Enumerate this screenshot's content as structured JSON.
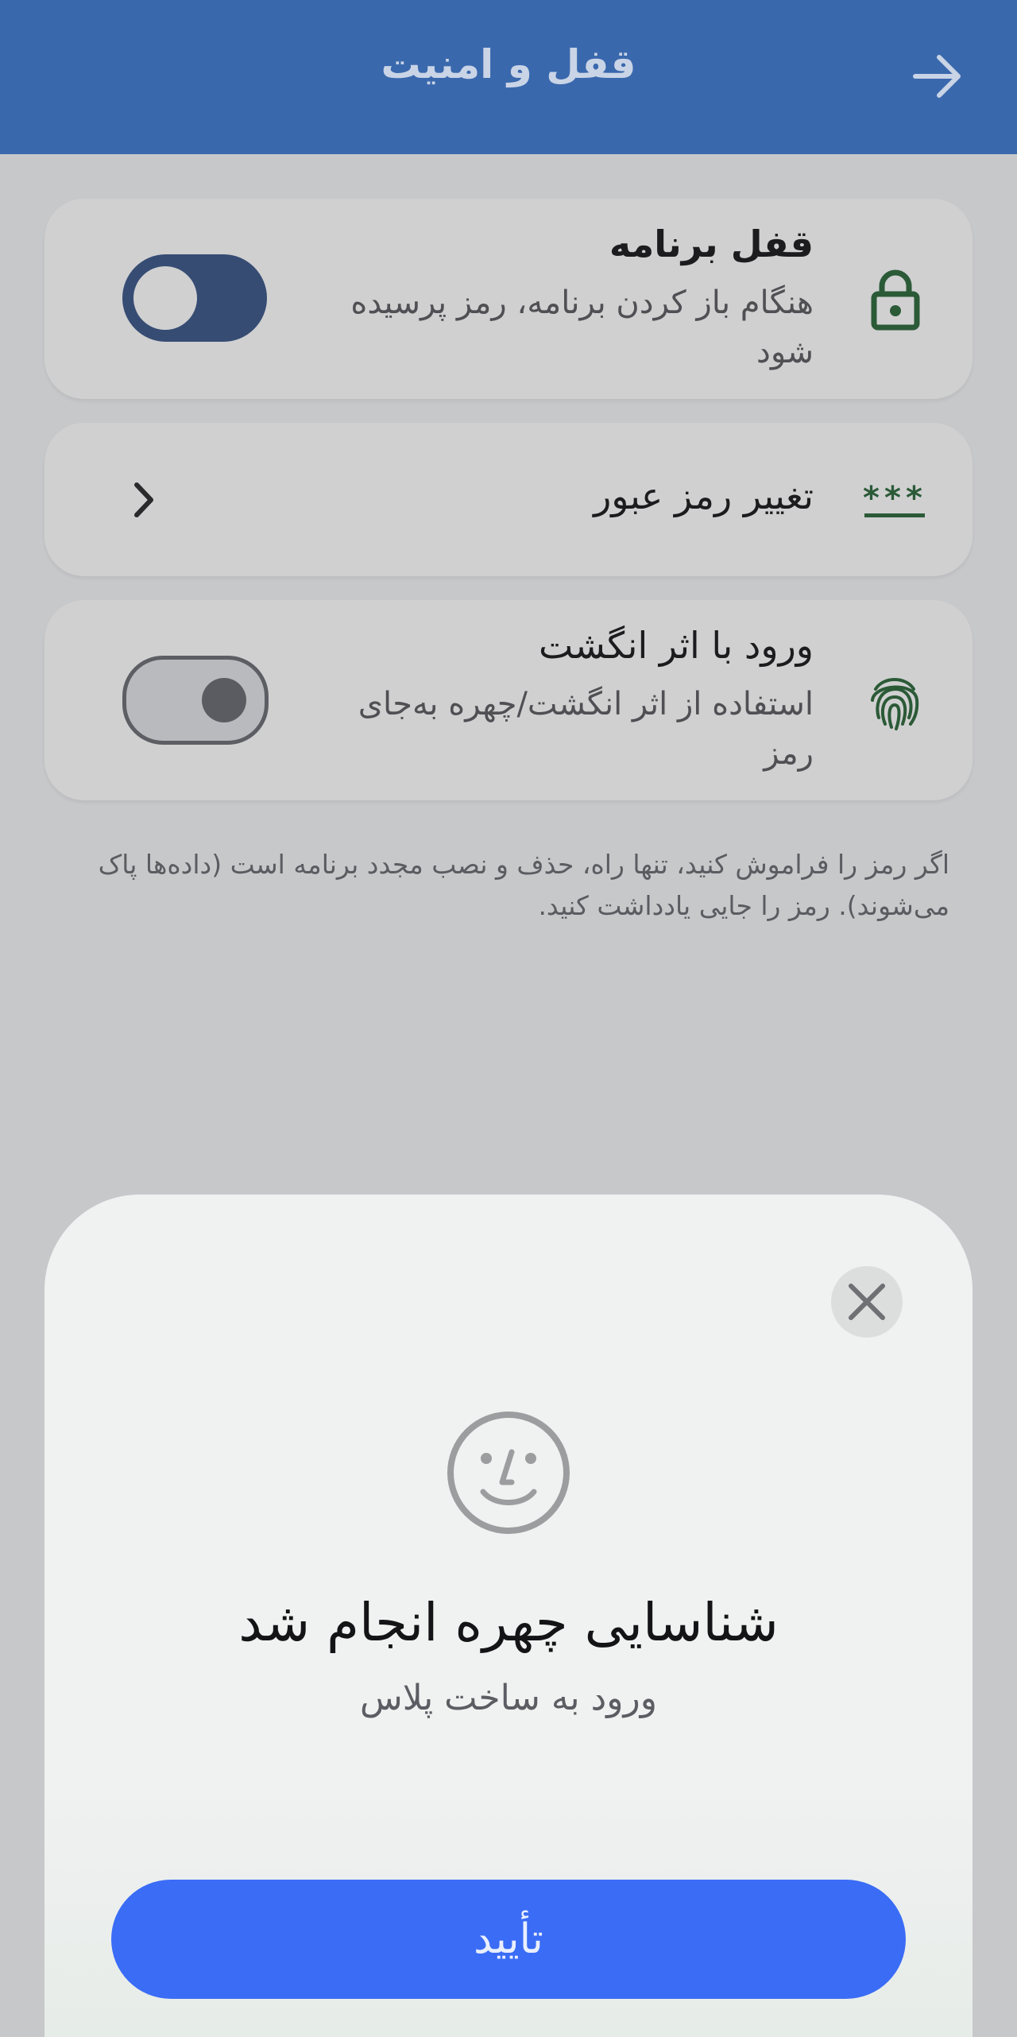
{
  "header": {
    "title": "قفل و امنیت",
    "back_icon": "arrow-right-icon"
  },
  "settings": {
    "app_lock": {
      "title": "قفل برنامه",
      "subtitle": "هنگام باز کردن برنامه، رمز پرسیده شود",
      "icon": "lock-icon",
      "enabled": true
    },
    "change_password": {
      "title": "تغییر رمز عبور",
      "icon": "password-icon",
      "chevron": "chevron-right-icon"
    },
    "fingerprint": {
      "title": "ورود با اثر انگشت",
      "subtitle": "استفاده از اثر انگشت/چهره به‌جای رمز",
      "icon": "fingerprint-icon",
      "enabled": false
    }
  },
  "note": "اگر رمز را فراموش کنید، تنها راه، حذف و نصب مجدد برنامه است (داده‌ها پاک می‌شوند). رمز را جایی یادداشت کنید.",
  "sheet": {
    "close_icon": "close-icon",
    "face_icon": "face-id-icon",
    "title": "شناسایی چهره انجام شد",
    "subtitle": "ورود به ساخت پلاس",
    "confirm_label": "تأیید"
  },
  "colors": {
    "header_bg": "#3a68ad",
    "accent": "#3a6cf6",
    "icon_green": "#2b5a37",
    "toggle_on": "#364c73"
  }
}
